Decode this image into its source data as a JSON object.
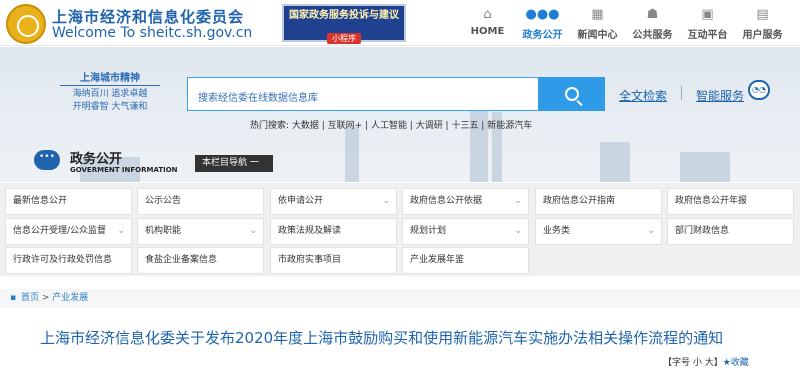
{
  "header": {
    "site_name_cn": "上海市经济和信息化委员会",
    "site_name_en": "Welcome  To  sheitc.sh.gov.cn",
    "banner_title": "国家政务服务投诉与建议",
    "banner_sub": "小程序"
  },
  "nav": [
    {
      "label": "HOME",
      "icon": "home-icon",
      "glyph": "⌂"
    },
    {
      "label": "政务公开",
      "icon": "chat-icon",
      "glyph": "●●●"
    },
    {
      "label": "新闻中心",
      "icon": "news-icon",
      "glyph": "▦"
    },
    {
      "label": "公共服务",
      "icon": "people-icon",
      "glyph": "☗"
    },
    {
      "label": "互动平台",
      "icon": "grid-icon",
      "glyph": "▣"
    },
    {
      "label": "用户服务",
      "icon": "user-icon",
      "glyph": "▤"
    }
  ],
  "hero": {
    "spirit_title": "上海城市精神",
    "spirit_line1": "海纳百川  追求卓越",
    "spirit_line2": "开明睿智  大气谦和",
    "search_placeholder": "搜索经信委在线数据信息库",
    "fulltext": "全文检索",
    "smart": "智能服务",
    "hot": "热门搜索: 大数据 | 互联网+ | 人工智能 | 大调研 | 十三五 | 新能源汽车"
  },
  "section": {
    "title_cn": "政务公开",
    "title_en": "GOVERMENT INFORMATION",
    "column_nav": "本栏目导航 一"
  },
  "grid": [
    [
      "最新信息公开",
      "公示公告",
      "依申请公开",
      "政府信息公开依据",
      "政府信息公开指南",
      "政府信息公开年报"
    ],
    [
      "信息公开受理/公众监督",
      "机构职能",
      "政策法规及解读",
      "规划计划",
      "业务类",
      "部门财政信息"
    ],
    [
      "行政许可及行政处罚信息",
      "食盐企业备案信息",
      "市政府实事项目",
      "产业发展年鉴"
    ]
  ],
  "breadcrumb": {
    "home": "首页",
    "sep": ">",
    "current": "产业发展"
  },
  "article": {
    "title": "上海市经济信息化委关于发布2020年度上海市鼓励购买和使用新能源汽车实施办法相关操作流程的通知",
    "font_tools": "【字号  小    大】",
    "favorite": "★收藏"
  }
}
